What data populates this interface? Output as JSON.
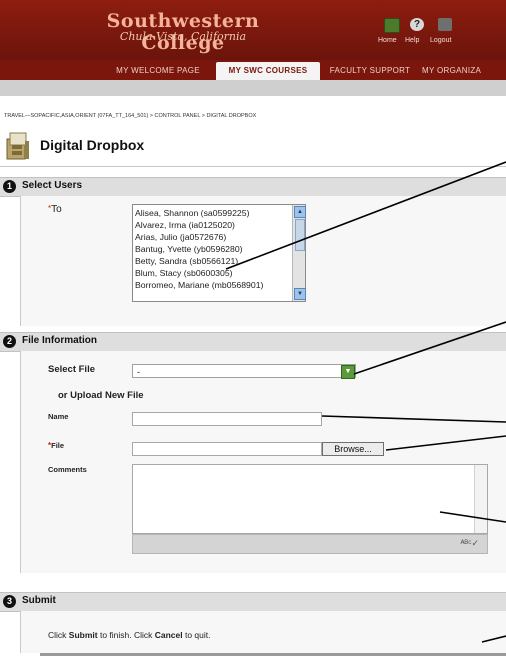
{
  "header": {
    "logo_line1": "Southwestern College",
    "logo_line2": "Chula Vista, California",
    "home_label": "Home",
    "help_label": "Help",
    "logout_label": "Logout"
  },
  "nav": {
    "tabs": [
      {
        "label": "MY WELCOME PAGE"
      },
      {
        "label": "MY SWC COURSES"
      },
      {
        "label": "FACULTY SUPPORT"
      },
      {
        "label": "MY ORGANIZA"
      }
    ],
    "active_tab": "MY SWC COURSES"
  },
  "breadcrumb": "TRAVEL—SOPACIFIC,ASIA,ORIENT (07FA_TT_164_501) > CONTROL PANEL > DIGITAL DROPBOX",
  "page_title": "Digital Dropbox",
  "steps": [
    {
      "num": "1",
      "label": "Select Users"
    },
    {
      "num": "2",
      "label": "File Information"
    },
    {
      "num": "3",
      "label": "Submit"
    }
  ],
  "select_users": {
    "required_mark": "*",
    "to_label": "To",
    "users": [
      "Alisea, Shannon (sa0599225)",
      "Alvarez, Irma (ia0125020)",
      "Arias, Julio (ja0572676)",
      "Bantug, Yvette (yb0596280)",
      "Betty, Sandra (sb0566121)",
      "Blum, Stacy (sb0600305)",
      "Borromeo, Mariane (mb0568901)"
    ]
  },
  "file_info": {
    "select_file_label": "Select File",
    "select_file_value": "-",
    "upload_label": "or Upload New File",
    "name_label": "Name",
    "file_label": "File",
    "browse_label": "Browse...",
    "comments_label": "Comments",
    "spell_glyph": "ᴬᴮᶜ✓"
  },
  "submit": {
    "pre": "Click ",
    "submit_word": "Submit",
    "mid": " to finish. Click ",
    "cancel_word": "Cancel",
    "post": " to quit."
  },
  "colors": {
    "header_red": "#7a160c",
    "required_red": "#cc2200",
    "step_bar": "#dedede"
  }
}
